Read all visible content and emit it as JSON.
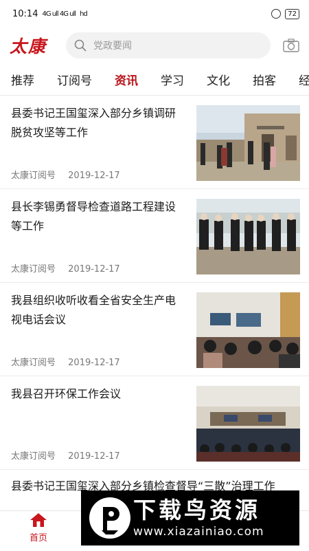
{
  "status_bar": {
    "time": "10:14",
    "signal": "4G ull 4G ull",
    "wifi": "hd",
    "battery": "72"
  },
  "header": {
    "logo": "太康",
    "search_placeholder": "党政要闻"
  },
  "tabs": [
    {
      "label": "推荐",
      "active": false
    },
    {
      "label": "订阅号",
      "active": false
    },
    {
      "label": "资讯",
      "active": true
    },
    {
      "label": "学习",
      "active": false
    },
    {
      "label": "文化",
      "active": false
    },
    {
      "label": "拍客",
      "active": false
    },
    {
      "label": "经济",
      "active": false
    }
  ],
  "articles": [
    {
      "title": "县委书记王国玺深入部分乡镇调研脱贫攻坚等工作",
      "source": "太康订阅号",
      "date": "2019-12-17"
    },
    {
      "title": "县长李锡勇督导检查道路工程建设等工作",
      "source": "太康订阅号",
      "date": "2019-12-17"
    },
    {
      "title": "我县组织收听收看全省安全生产电视电话会议",
      "source": "太康订阅号",
      "date": "2019-12-17"
    },
    {
      "title": "我县召开环保工作会议",
      "source": "太康订阅号",
      "date": "2019-12-17"
    }
  ],
  "partial_article": {
    "title": "县委书记王国玺深入部分乡镇检查督导“三散”治理工作"
  },
  "bottom_nav": {
    "home_label": "首页"
  },
  "watermark": {
    "title": "下载鸟资源",
    "url": "www.xiazainiao.com"
  },
  "colors": {
    "brand": "#c8161d",
    "active_tab": "#b8141b"
  }
}
